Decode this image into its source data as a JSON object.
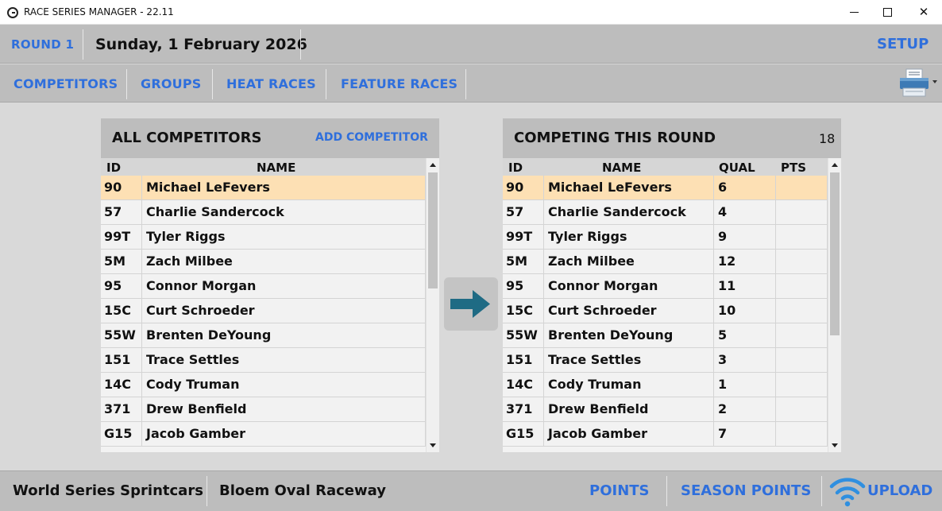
{
  "window": {
    "title": "RACE SERIES MANAGER - 22.11",
    "icon": "app-logo-icon",
    "controls": {
      "minimize": "minimize-icon",
      "maximize": "maximize-icon",
      "close": "close-icon"
    }
  },
  "header": {
    "round": "ROUND 1",
    "date": "Sunday, 1 February 2026",
    "setup": "SETUP"
  },
  "tabs": [
    {
      "label": "COMPETITORS"
    },
    {
      "label": "GROUPS"
    },
    {
      "label": "HEAT RACES"
    },
    {
      "label": "FEATURE RACES"
    }
  ],
  "print_icon": "printer-icon",
  "colors": {
    "accent": "#2f6fdc",
    "selected_row": "#fde0b4",
    "arrow": "#1f6b84",
    "panel_header": "#bdbdbd"
  },
  "all_competitors": {
    "title": "ALL COMPETITORS",
    "add_label": "ADD COMPETITOR",
    "columns": [
      "ID",
      "NAME"
    ],
    "rows": [
      {
        "id": "90",
        "name": "Michael LeFevers"
      },
      {
        "id": "57",
        "name": "Charlie Sandercock"
      },
      {
        "id": "99T",
        "name": "Tyler Riggs"
      },
      {
        "id": "5M",
        "name": "Zach Milbee"
      },
      {
        "id": "95",
        "name": "Connor Morgan"
      },
      {
        "id": "15C",
        "name": "Curt Schroeder"
      },
      {
        "id": "55W",
        "name": "Brenten DeYoung"
      },
      {
        "id": "151",
        "name": "Trace Settles"
      },
      {
        "id": "14C",
        "name": "Cody Truman"
      },
      {
        "id": "371",
        "name": "Drew Benfield"
      },
      {
        "id": "G15",
        "name": "Jacob Gamber"
      }
    ],
    "selected_index": 0
  },
  "move_button_icon": "arrow-right-icon",
  "competing": {
    "title": "COMPETING THIS ROUND",
    "count": "18",
    "columns": [
      "ID",
      "NAME",
      "QUAL",
      "PTS"
    ],
    "rows": [
      {
        "id": "90",
        "name": "Michael LeFevers",
        "qual": "6",
        "pts": ""
      },
      {
        "id": "57",
        "name": "Charlie Sandercock",
        "qual": "4",
        "pts": ""
      },
      {
        "id": "99T",
        "name": "Tyler Riggs",
        "qual": "9",
        "pts": ""
      },
      {
        "id": "5M",
        "name": "Zach Milbee",
        "qual": "12",
        "pts": ""
      },
      {
        "id": "95",
        "name": "Connor Morgan",
        "qual": "11",
        "pts": ""
      },
      {
        "id": "15C",
        "name": "Curt Schroeder",
        "qual": "10",
        "pts": ""
      },
      {
        "id": "55W",
        "name": "Brenten DeYoung",
        "qual": "5",
        "pts": ""
      },
      {
        "id": "151",
        "name": "Trace Settles",
        "qual": "3",
        "pts": ""
      },
      {
        "id": "14C",
        "name": "Cody Truman",
        "qual": "1",
        "pts": ""
      },
      {
        "id": "371",
        "name": "Drew Benfield",
        "qual": "2",
        "pts": ""
      },
      {
        "id": "G15",
        "name": "Jacob Gamber",
        "qual": "7",
        "pts": ""
      }
    ],
    "selected_index": 0
  },
  "footer": {
    "series": "World Series Sprintcars",
    "track": "Bloem Oval Raceway",
    "points": "POINTS",
    "season_points": "SEASON POINTS",
    "upload": "UPLOAD",
    "upload_icon": "wifi-icon"
  }
}
